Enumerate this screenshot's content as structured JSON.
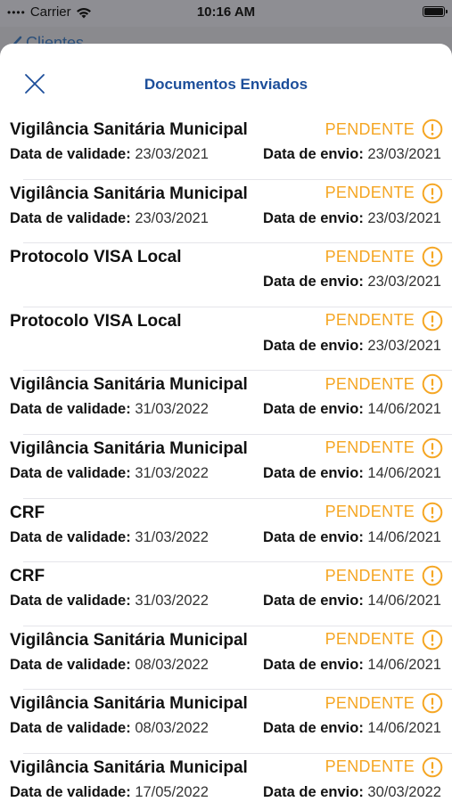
{
  "status_bar": {
    "carrier": "Carrier",
    "time": "10:16 AM"
  },
  "nav": {
    "back_label": "Clientes"
  },
  "sheet": {
    "title": "Documentos Enviados"
  },
  "labels": {
    "validade": "Data de validade:",
    "envio": "Data de envio:"
  },
  "colors": {
    "title": "#1c4e9a",
    "pending": "#f5a623"
  },
  "documents": [
    {
      "name": "Vigilância Sanitária Municipal",
      "status": "PENDENTE",
      "validade": "23/03/2021",
      "envio": "23/03/2021"
    },
    {
      "name": "Vigilância Sanitária Municipal",
      "status": "PENDENTE",
      "validade": "23/03/2021",
      "envio": "23/03/2021"
    },
    {
      "name": "Protocolo VISA Local",
      "status": "PENDENTE",
      "validade": null,
      "envio": "23/03/2021"
    },
    {
      "name": "Protocolo VISA Local",
      "status": "PENDENTE",
      "validade": null,
      "envio": "23/03/2021"
    },
    {
      "name": "Vigilância Sanitária Municipal",
      "status": "PENDENTE",
      "validade": "31/03/2022",
      "envio": "14/06/2021"
    },
    {
      "name": "Vigilância Sanitária Municipal",
      "status": "PENDENTE",
      "validade": "31/03/2022",
      "envio": "14/06/2021"
    },
    {
      "name": "CRF",
      "status": "PENDENTE",
      "validade": "31/03/2022",
      "envio": "14/06/2021"
    },
    {
      "name": "CRF",
      "status": "PENDENTE",
      "validade": "31/03/2022",
      "envio": "14/06/2021"
    },
    {
      "name": "Vigilância Sanitária Municipal",
      "status": "PENDENTE",
      "validade": "08/03/2022",
      "envio": "14/06/2021"
    },
    {
      "name": "Vigilância Sanitária Municipal",
      "status": "PENDENTE",
      "validade": "08/03/2022",
      "envio": "14/06/2021"
    },
    {
      "name": "Vigilância Sanitária Municipal",
      "status": "PENDENTE",
      "validade": "17/05/2022",
      "envio": "30/03/2022"
    }
  ]
}
